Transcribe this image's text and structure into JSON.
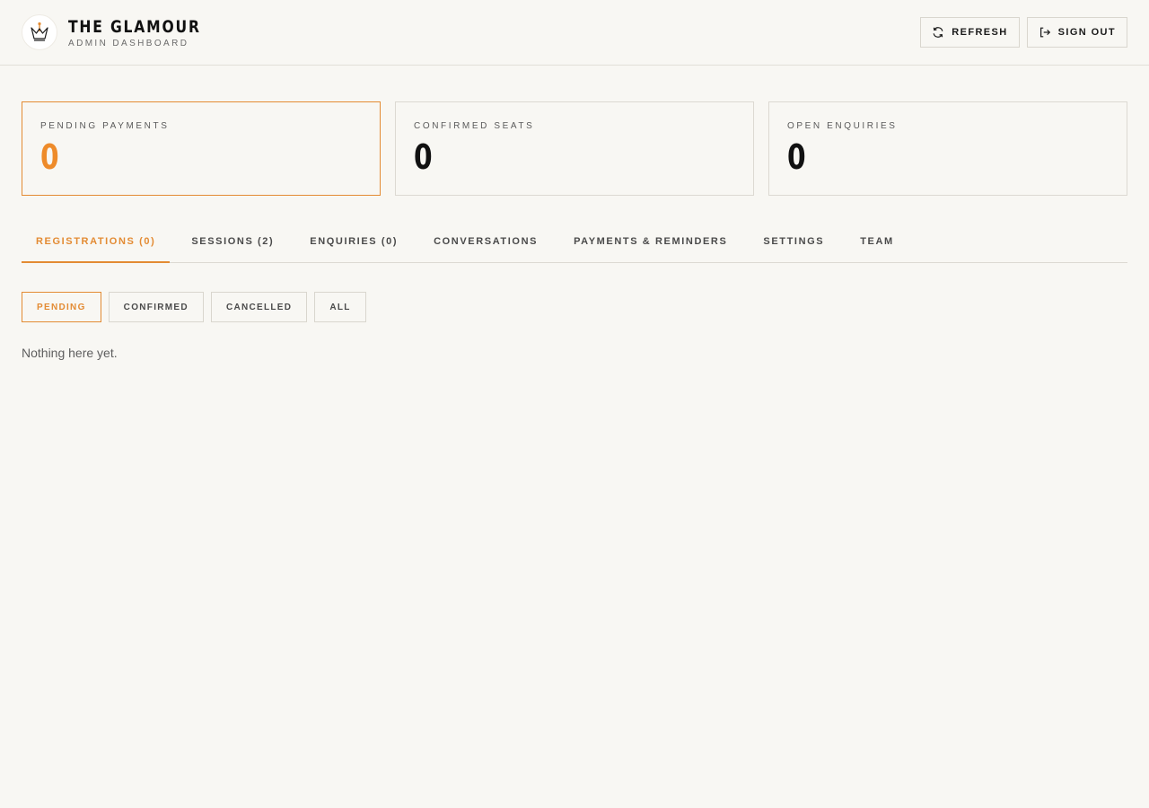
{
  "header": {
    "brand_title": "THE GLAMOUR",
    "brand_subtitle": "ADMIN DASHBOARD",
    "logo_icon": "crown-icon",
    "refresh_label": "REFRESH",
    "refresh_icon": "refresh-icon",
    "signout_label": "SIGN OUT",
    "signout_icon": "sign-out-icon"
  },
  "stats": [
    {
      "label": "PENDING PAYMENTS",
      "value": "0"
    },
    {
      "label": "CONFIRMED SEATS",
      "value": "0"
    },
    {
      "label": "OPEN ENQUIRIES",
      "value": "0"
    }
  ],
  "tabs": [
    {
      "label": "REGISTRATIONS (0)"
    },
    {
      "label": "SESSIONS (2)"
    },
    {
      "label": "ENQUIRIES (0)"
    },
    {
      "label": "CONVERSATIONS"
    },
    {
      "label": "PAYMENTS & REMINDERS"
    },
    {
      "label": "SETTINGS"
    },
    {
      "label": "TEAM"
    }
  ],
  "filters": [
    {
      "label": "PENDING"
    },
    {
      "label": "CONFIRMED"
    },
    {
      "label": "CANCELLED"
    },
    {
      "label": "ALL"
    }
  ],
  "empty_state": "Nothing here yet.",
  "colors": {
    "accent": "#e38b33",
    "background": "#f8f7f3",
    "border": "#dcd9d2"
  }
}
